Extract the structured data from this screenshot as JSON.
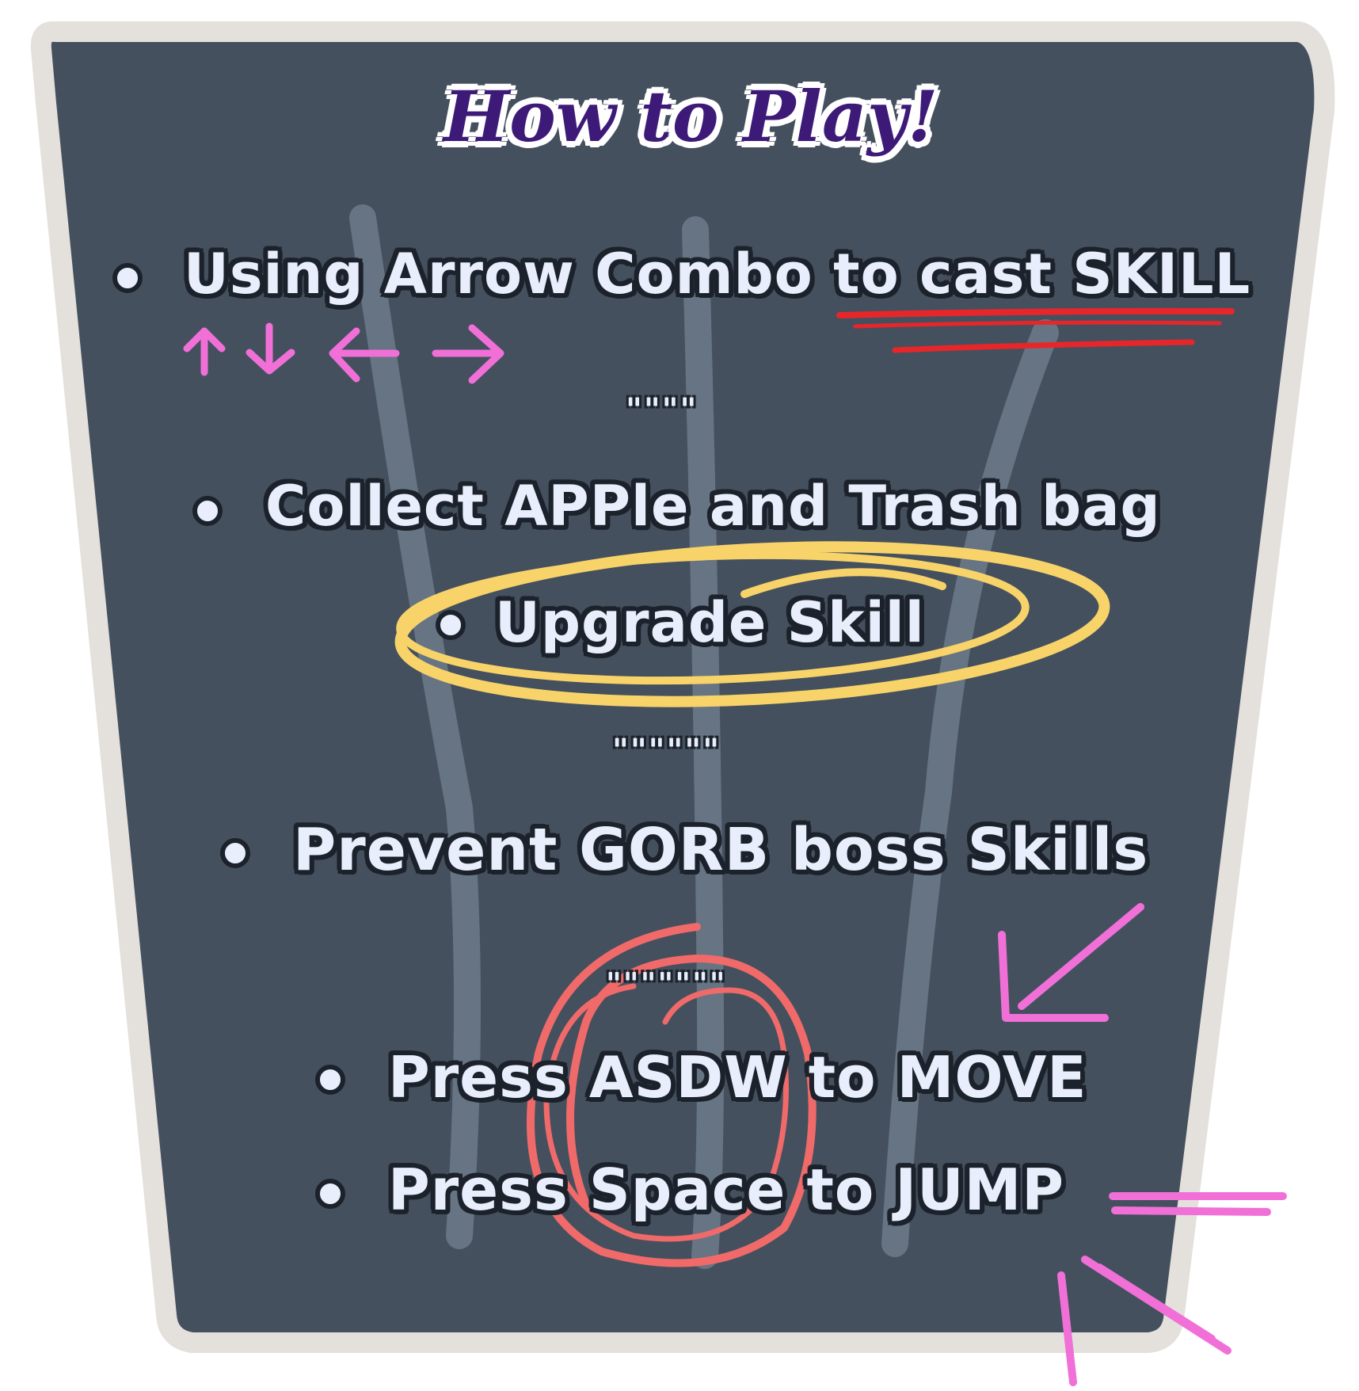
{
  "title": "How to Play!",
  "separators": [
    "\"\"\"\"",
    "\"\"\"\"\"\"",
    "\"\"\"\"\"\"\""
  ],
  "instructions": [
    {
      "text": "Using Arrow Combo to cast SKILL"
    },
    {
      "text": "Collect APPle and Trash bag"
    },
    {
      "text": "Upgrade Skill"
    },
    {
      "text": "Prevent GORB boss Skills"
    },
    {
      "text": "Press ASDW to MOVE"
    },
    {
      "text": "Press Space to JUMP"
    }
  ],
  "arrow_combo_icons": [
    "arrow-up-icon",
    "arrow-down-icon",
    "arrow-left-icon",
    "arrow-right-icon"
  ],
  "colors": {
    "board": "#45505e",
    "board_border": "#e4e0dc",
    "stroke": "#697887",
    "title": "#3d1a78",
    "text": "#e8eefb",
    "underline": "#e8262a",
    "highlight_circle": "#f7d36a",
    "key_circle": "#f06a6a",
    "pink_marks": "#f070d8"
  }
}
